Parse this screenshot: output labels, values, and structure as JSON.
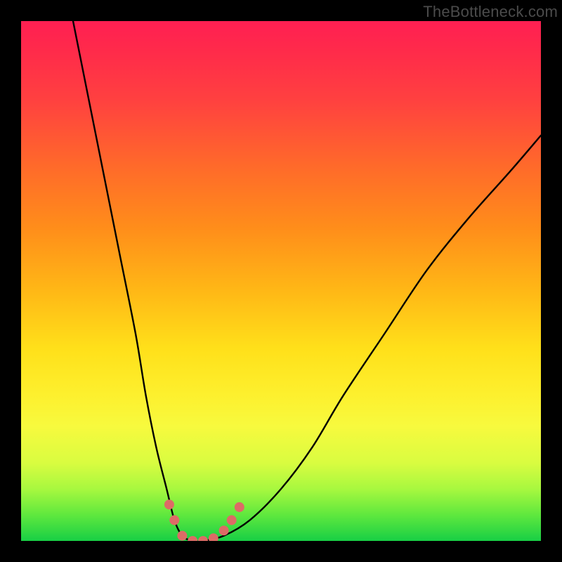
{
  "watermark": "TheBottleneck.com",
  "chart_data": {
    "type": "line",
    "title": "",
    "xlabel": "",
    "ylabel": "",
    "xlim": [
      0,
      100
    ],
    "ylim": [
      0,
      100
    ],
    "note": "Bottleneck / mismatch style V-curve. Axes and ticks not shown; values are read off relative plot position (0=bottom/left, 100=top/right).",
    "x": [
      10,
      13,
      16,
      19,
      22,
      24,
      26,
      28,
      29.5,
      31,
      33,
      35,
      39,
      44,
      50,
      56,
      62,
      70,
      78,
      86,
      94,
      100
    ],
    "values": [
      100,
      85,
      70,
      55,
      40,
      28,
      18,
      10,
      4,
      1,
      0,
      0,
      1,
      4,
      10,
      18,
      28,
      40,
      52,
      62,
      71,
      78
    ],
    "series": [
      {
        "name": "mismatch-curve",
        "color": "#000000",
        "x": [
          10,
          13,
          16,
          19,
          22,
          24,
          26,
          28,
          29.5,
          31,
          33,
          35,
          39,
          44,
          50,
          56,
          62,
          70,
          78,
          86,
          94,
          100
        ],
        "y": [
          100,
          85,
          70,
          55,
          40,
          28,
          18,
          10,
          4,
          1,
          0,
          0,
          1,
          4,
          10,
          18,
          28,
          40,
          52,
          62,
          71,
          78
        ]
      },
      {
        "name": "marker-dots",
        "color": "#dd6b66",
        "points": [
          {
            "x": 28.5,
            "y": 7
          },
          {
            "x": 29.5,
            "y": 4
          },
          {
            "x": 31,
            "y": 1
          },
          {
            "x": 33,
            "y": 0
          },
          {
            "x": 35,
            "y": 0
          },
          {
            "x": 37,
            "y": 0.5
          },
          {
            "x": 39,
            "y": 2
          },
          {
            "x": 40.5,
            "y": 4
          },
          {
            "x": 42,
            "y": 6.5
          }
        ]
      }
    ]
  }
}
